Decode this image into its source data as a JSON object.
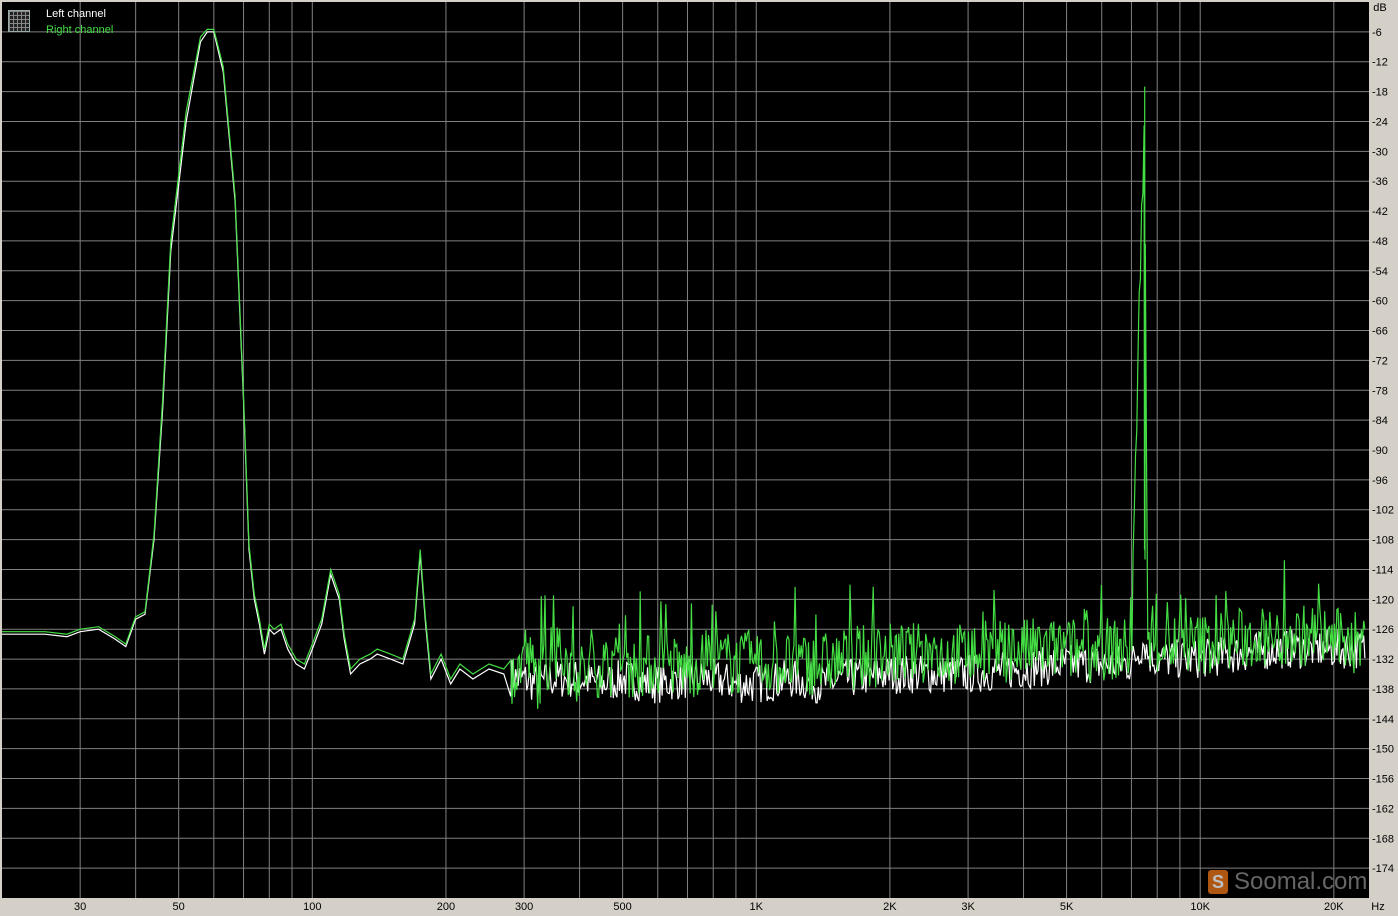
{
  "legend": {
    "left_label": "Left channel",
    "right_label": "Right channel"
  },
  "watermark": {
    "text": "Soomal.com",
    "icon_glyph": "S"
  },
  "colors": {
    "background": "#000000",
    "grid": "#808080",
    "left_channel": "#ffffff",
    "right_channel": "#44dd44",
    "frame": "#d4d0c8"
  },
  "chart_data": {
    "type": "line",
    "title": "",
    "xlabel": "",
    "ylabel": "",
    "x_scale": "log",
    "xlim": [
      20,
      24000
    ],
    "ylim": [
      -180,
      0
    ],
    "grid": true,
    "legend_position": "top-left",
    "x_ticks": [
      {
        "value": 30,
        "label": "30"
      },
      {
        "value": 50,
        "label": "50"
      },
      {
        "value": 100,
        "label": "100"
      },
      {
        "value": 200,
        "label": "200"
      },
      {
        "value": 300,
        "label": "300"
      },
      {
        "value": 500,
        "label": "500"
      },
      {
        "value": 1000,
        "label": "1K"
      },
      {
        "value": 2000,
        "label": "2K"
      },
      {
        "value": 3000,
        "label": "3K"
      },
      {
        "value": 5000,
        "label": "5K"
      },
      {
        "value": 10000,
        "label": "10K"
      },
      {
        "value": 20000,
        "label": "20K"
      }
    ],
    "x_unit": "Hz",
    "y_unit": "dB",
    "y_ticks": [
      -6,
      -12,
      -18,
      -24,
      -30,
      -36,
      -42,
      -48,
      -54,
      -60,
      -66,
      -72,
      -78,
      -84,
      -90,
      -96,
      -102,
      -108,
      -114,
      -120,
      -126,
      -132,
      -138,
      -144,
      -150,
      -156,
      -162,
      -168,
      -174
    ],
    "series": [
      {
        "name": "Left channel",
        "color": "#ffffff",
        "points": [
          [
            20,
            -127
          ],
          [
            25,
            -127
          ],
          [
            28,
            -127.5
          ],
          [
            30,
            -126.5
          ],
          [
            33,
            -126
          ],
          [
            36,
            -128
          ],
          [
            38,
            -129.5
          ],
          [
            40,
            -124
          ],
          [
            42,
            -123
          ],
          [
            44,
            -108
          ],
          [
            46,
            -82
          ],
          [
            48,
            -50
          ],
          [
            52,
            -24
          ],
          [
            56,
            -8
          ],
          [
            58,
            -6
          ],
          [
            60,
            -6
          ],
          [
            63,
            -14
          ],
          [
            67,
            -40
          ],
          [
            70,
            -80
          ],
          [
            72,
            -110
          ],
          [
            74,
            -120
          ],
          [
            76,
            -125
          ],
          [
            78,
            -131
          ],
          [
            80,
            -126
          ],
          [
            82,
            -127
          ],
          [
            85,
            -126
          ],
          [
            88,
            -130
          ],
          [
            92,
            -133
          ],
          [
            96,
            -134
          ],
          [
            100,
            -130
          ],
          [
            105,
            -125
          ],
          [
            110,
            -115
          ],
          [
            115,
            -120
          ],
          [
            118,
            -128
          ],
          [
            122,
            -135
          ],
          [
            128,
            -133
          ],
          [
            135,
            -132
          ],
          [
            140,
            -131
          ],
          [
            150,
            -132
          ],
          [
            160,
            -133
          ],
          [
            170,
            -125
          ],
          [
            175,
            -111
          ],
          [
            180,
            -125
          ],
          [
            185,
            -136
          ],
          [
            195,
            -132
          ],
          [
            205,
            -137
          ],
          [
            215,
            -134
          ],
          [
            230,
            -136
          ],
          [
            250,
            -134
          ],
          [
            270,
            -135
          ],
          [
            290,
            -136
          ],
          [
            300,
            -136
          ],
          [
            320,
            -137
          ],
          [
            350,
            -136
          ],
          [
            400,
            -136
          ],
          [
            450,
            -137
          ],
          [
            500,
            -136
          ],
          [
            600,
            -137
          ],
          [
            700,
            -136
          ],
          [
            800,
            -136
          ],
          [
            900,
            -137
          ],
          [
            1000,
            -137
          ],
          [
            1200,
            -136
          ],
          [
            1400,
            -137
          ],
          [
            1600,
            -136
          ],
          [
            2000,
            -135
          ],
          [
            2500,
            -135
          ],
          [
            3000,
            -135
          ],
          [
            4000,
            -134
          ],
          [
            5000,
            -133
          ],
          [
            6000,
            -133
          ],
          [
            7000,
            -133
          ],
          [
            7500,
            -128
          ],
          [
            7600,
            -131
          ],
          [
            8000,
            -132
          ],
          [
            10000,
            -132
          ],
          [
            12000,
            -131
          ],
          [
            15000,
            -130
          ],
          [
            18000,
            -130
          ],
          [
            20000,
            -130
          ],
          [
            23000,
            -130
          ]
        ]
      },
      {
        "name": "Right channel",
        "color": "#44dd44",
        "points": [
          [
            20,
            -126.5
          ],
          [
            25,
            -126.5
          ],
          [
            28,
            -127
          ],
          [
            30,
            -126
          ],
          [
            33,
            -125.5
          ],
          [
            36,
            -127.5
          ],
          [
            38,
            -129
          ],
          [
            40,
            -123.5
          ],
          [
            42,
            -122.5
          ],
          [
            44,
            -107
          ],
          [
            46,
            -80
          ],
          [
            48,
            -48
          ],
          [
            52,
            -22
          ],
          [
            56,
            -7
          ],
          [
            58,
            -5.5
          ],
          [
            60,
            -5.5
          ],
          [
            63,
            -13
          ],
          [
            67,
            -39
          ],
          [
            70,
            -79
          ],
          [
            72,
            -109
          ],
          [
            74,
            -119
          ],
          [
            76,
            -124
          ],
          [
            78,
            -130
          ],
          [
            80,
            -125
          ],
          [
            82,
            -126
          ],
          [
            85,
            -125
          ],
          [
            88,
            -129
          ],
          [
            92,
            -132
          ],
          [
            96,
            -133
          ],
          [
            100,
            -129
          ],
          [
            105,
            -124
          ],
          [
            110,
            -114
          ],
          [
            115,
            -119
          ],
          [
            118,
            -127
          ],
          [
            122,
            -134
          ],
          [
            128,
            -132
          ],
          [
            135,
            -131
          ],
          [
            140,
            -130
          ],
          [
            150,
            -131
          ],
          [
            160,
            -132
          ],
          [
            170,
            -124
          ],
          [
            175,
            -110
          ],
          [
            180,
            -124
          ],
          [
            185,
            -135
          ],
          [
            195,
            -131
          ],
          [
            205,
            -136
          ],
          [
            215,
            -133
          ],
          [
            230,
            -135
          ],
          [
            250,
            -133
          ],
          [
            270,
            -134
          ],
          [
            290,
            -135
          ],
          [
            300,
            -130
          ],
          [
            320,
            -136
          ],
          [
            350,
            -131
          ],
          [
            400,
            -135
          ],
          [
            450,
            -133
          ],
          [
            500,
            -134
          ],
          [
            600,
            -133
          ],
          [
            700,
            -134
          ],
          [
            800,
            -132
          ],
          [
            900,
            -133
          ],
          [
            1000,
            -133
          ],
          [
            1200,
            -133
          ],
          [
            1400,
            -133
          ],
          [
            1600,
            -132
          ],
          [
            2000,
            -131
          ],
          [
            2500,
            -131
          ],
          [
            3000,
            -131
          ],
          [
            4000,
            -130
          ],
          [
            5000,
            -130
          ],
          [
            6000,
            -130
          ],
          [
            7000,
            -130
          ],
          [
            7500,
            -17
          ],
          [
            7600,
            -130
          ],
          [
            8000,
            -129
          ],
          [
            10000,
            -129
          ],
          [
            12000,
            -128
          ],
          [
            15000,
            -128
          ],
          [
            18000,
            -127
          ],
          [
            20000,
            -128
          ],
          [
            23000,
            -129
          ]
        ]
      }
    ],
    "noise_floor": {
      "from_hz": 280,
      "to_hz": 23500,
      "left_center_db": -134,
      "right_center_db": -131,
      "spread_db": 8
    }
  }
}
